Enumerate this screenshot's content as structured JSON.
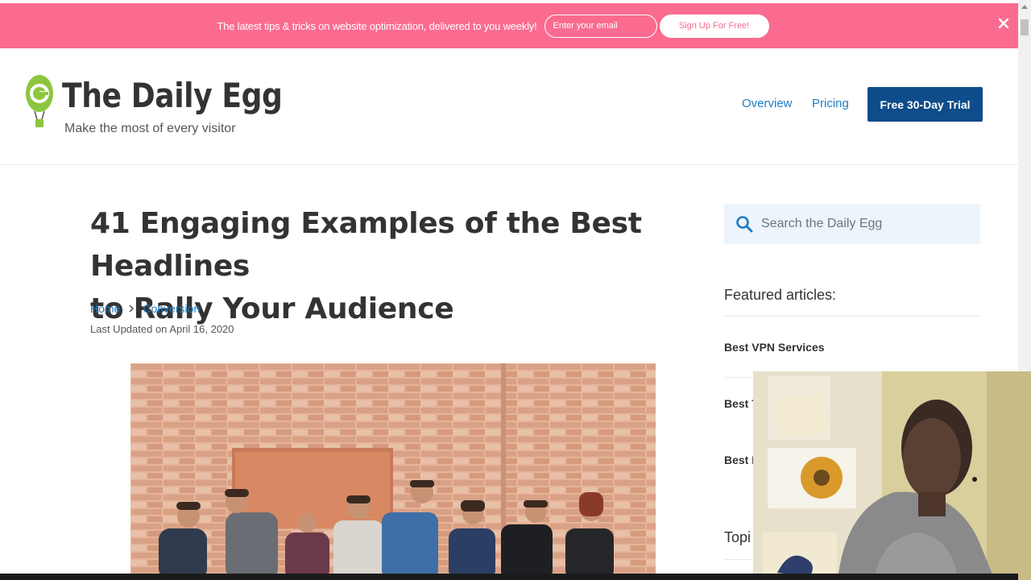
{
  "promo": {
    "text": "The latest tips & tricks on website optimization, delivered to you weekly!",
    "email_placeholder": "Enter your email",
    "signup_label": "Sign Up For Free!",
    "close_icon": "close-icon"
  },
  "header": {
    "logo_title": "The Daily Egg",
    "logo_tagline": "Make the most of every visitor",
    "nav": [
      "Overview",
      "Pricing"
    ],
    "cta_label": "Free 30-Day Trial"
  },
  "article": {
    "title_line1": "41 Engaging Examples of the Best Headlines",
    "title_line2": "to Rally Your Audience",
    "breadcrumb": [
      "Home",
      "Conversion"
    ],
    "updated": "Last Updated on April 16, 2020"
  },
  "sidebar": {
    "search_placeholder": "Search the Daily Egg",
    "featured_heading": "Featured articles:",
    "featured_items": [
      "Best VPN Services",
      "Best T",
      "Best I"
    ],
    "topics_heading": "Topi"
  },
  "colors": {
    "promo_bg": "#fb6b8f",
    "link": "#1f7bc1",
    "cta_bg": "#0f4c8a",
    "logo_green": "#8cc63f",
    "search_bg": "#edf4fc"
  }
}
